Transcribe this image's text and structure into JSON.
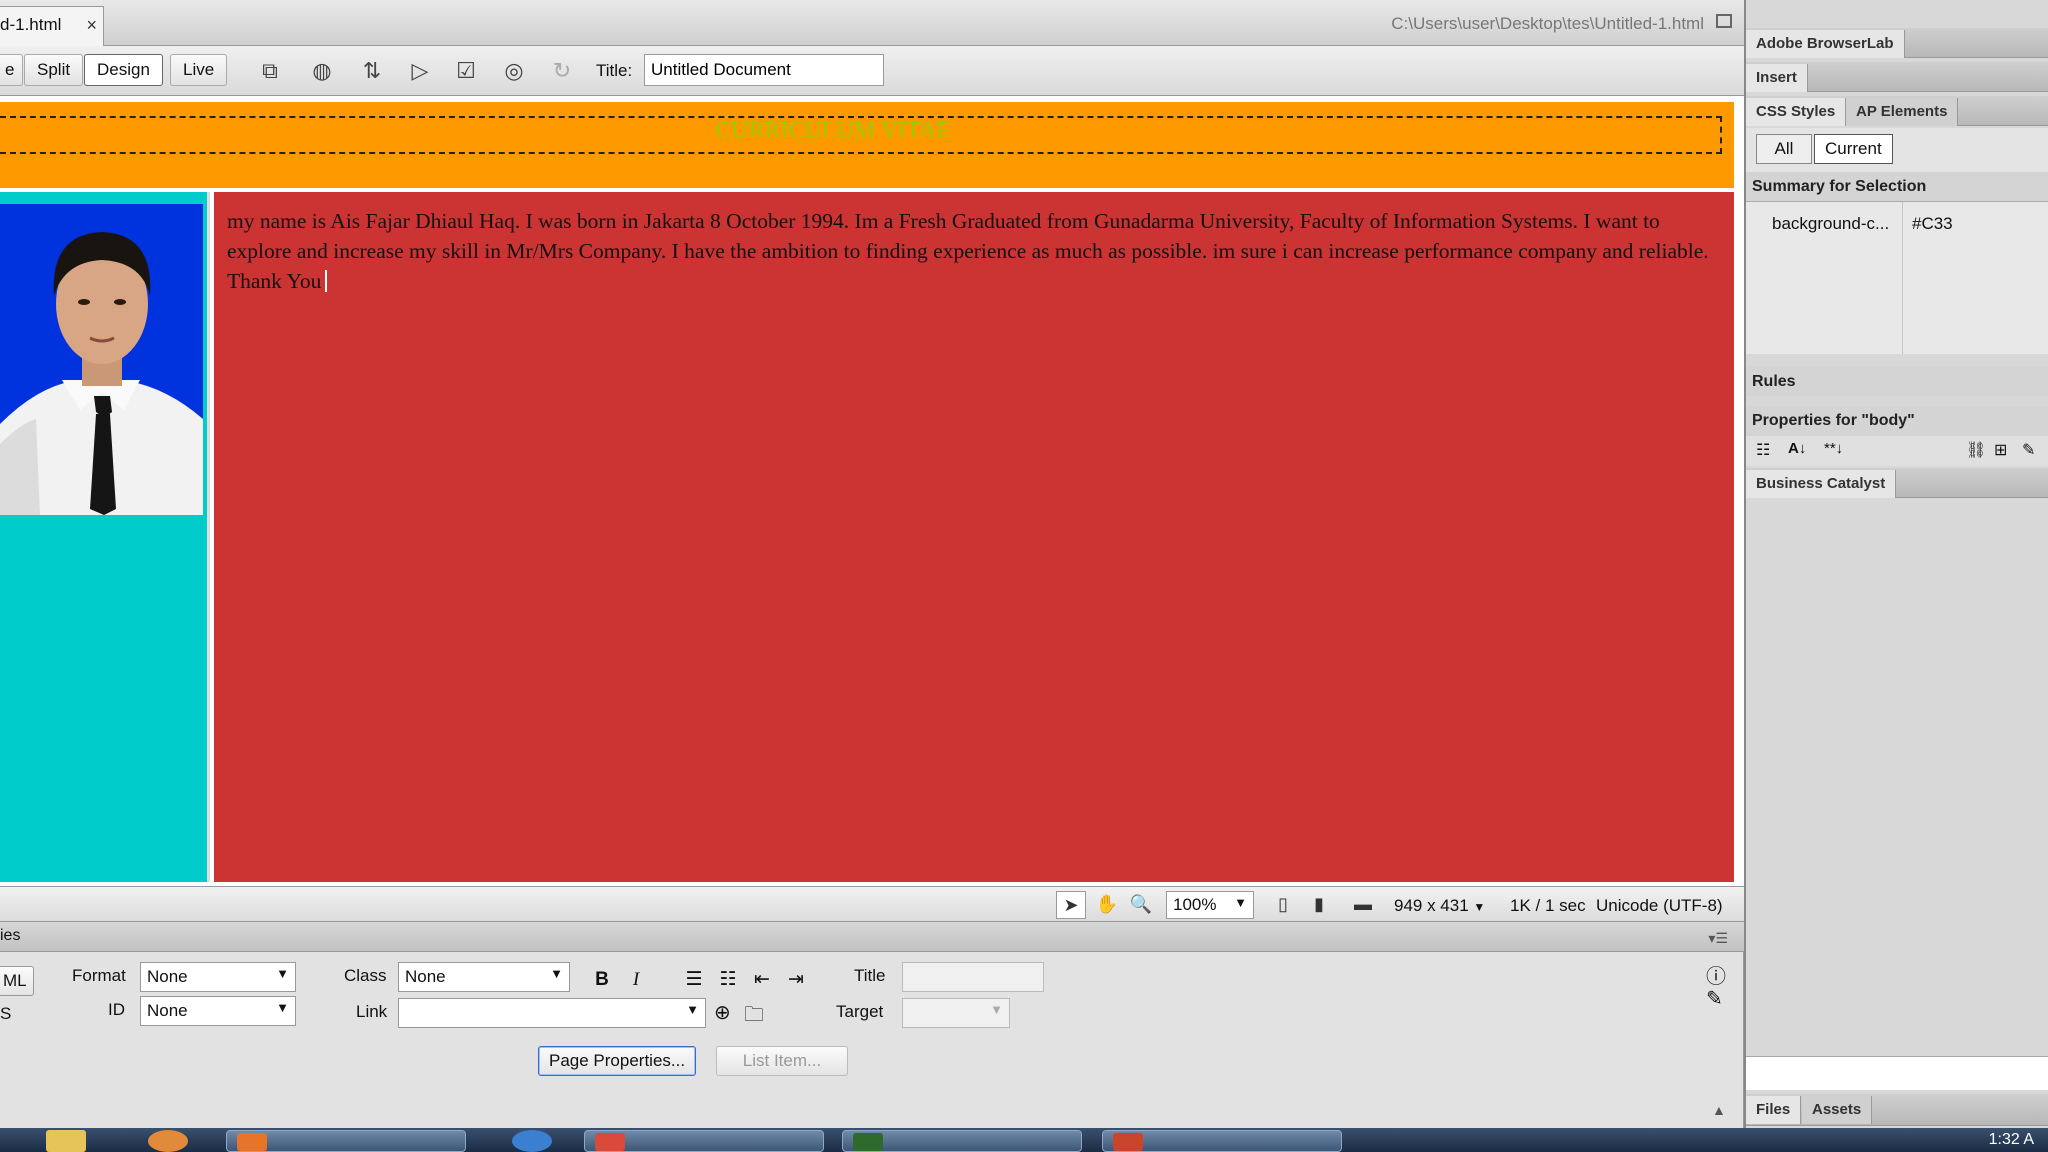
{
  "document_tab": {
    "filename": "d-1.html",
    "close": "×"
  },
  "window_path": "C:\\Users\\user\\Desktop\\tes\\Untitled-1.html",
  "toolbar": {
    "code_partial": "e",
    "split": "Split",
    "design": "Design",
    "live": "Live",
    "title_label": "Title:",
    "title_value": "Untitled Document"
  },
  "page": {
    "header_title": "CURRICULUM VITAE",
    "bio": "my name is Ais Fajar Dhiaul Haq. I was born in Jakarta 8 October 1994. Im a Fresh Graduated from Gunadarma University, Faculty of Information Systems. I want to explore and increase my skill in Mr/Mrs Company. I have the ambition to finding experience as much as possible. im sure i can increase performance company and reliable. Thank You",
    "colors": {
      "header": "#ff9900",
      "header_text": "#99cc00",
      "sidebar": "#00cccc",
      "main": "#cc3333",
      "photo_bg": "#0033dd"
    }
  },
  "statusbar": {
    "zoom": "100%",
    "window_size": "949 x 431",
    "download": "1K / 1 sec",
    "encoding": "Unicode (UTF-8)"
  },
  "properties": {
    "header_partial": "ies",
    "html_partial": "ML",
    "css_partial": "S",
    "format_label": "Format",
    "format_value": "None",
    "id_label": "ID",
    "id_value": "None",
    "class_label": "Class",
    "class_value": "None",
    "link_label": "Link",
    "title_label": "Title",
    "target_label": "Target",
    "page_properties_button": "Page Properties...",
    "list_item_button": "List Item..."
  },
  "right_panel": {
    "browserlab": "Adobe BrowserLab",
    "insert": "Insert",
    "css_styles": "CSS Styles",
    "ap_elements": "AP Elements",
    "all": "All",
    "current": "Current",
    "summary_label": "Summary for Selection",
    "summary_property": "background-c...",
    "summary_value": "#C33",
    "rules_label": "Rules",
    "properties_for": "Properties for \"body\"",
    "business_catalyst": "Business Catalyst",
    "files": "Files",
    "assets": "Assets"
  },
  "taskbar": {
    "clock": "1:32 A"
  }
}
